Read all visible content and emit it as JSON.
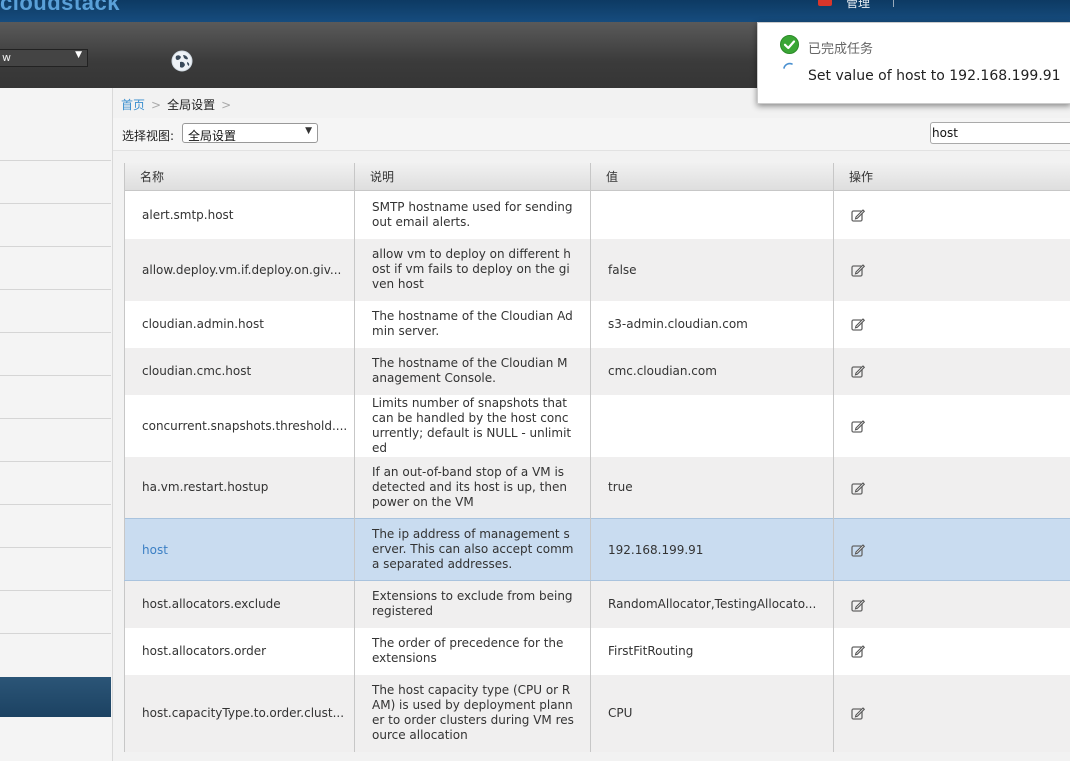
{
  "header": {
    "logo": "cloudstack",
    "user_name": "管理"
  },
  "toolbar": {
    "view_value": "w"
  },
  "breadcrumb": {
    "home": "首页",
    "separator": ">",
    "current": "全局设置",
    "trailing": ">"
  },
  "filter": {
    "label": "选择视图:",
    "selected": "全局设置",
    "search_value": "host"
  },
  "notification": {
    "done_label": "已完成任务",
    "task_text": "Set value of host to 192.168.199.91"
  },
  "table": {
    "headers": [
      "名称",
      "说明",
      "值",
      "操作"
    ],
    "rows": [
      {
        "name": "alert.smtp.host",
        "description": "SMTP hostname used for sending out email alerts.",
        "value": ""
      },
      {
        "name": "allow.deploy.vm.if.deploy.on.giv...",
        "description": "allow vm to deploy on different host if vm fails to deploy on the given host",
        "value": "false"
      },
      {
        "name": "cloudian.admin.host",
        "description": "The hostname of the Cloudian Admin server.",
        "value": "s3-admin.cloudian.com"
      },
      {
        "name": "cloudian.cmc.host",
        "description": "The hostname of the Cloudian Management Console.",
        "value": "cmc.cloudian.com"
      },
      {
        "name": "concurrent.snapshots.threshold....",
        "description": "Limits number of snapshots that can be handled by the host concurrently; default is NULL - unlimited",
        "value": ""
      },
      {
        "name": "ha.vm.restart.hostup",
        "description": "If an out-of-band stop of a VM is detected and its host is up, then power on the VM",
        "value": "true"
      },
      {
        "name": "host",
        "description": "The ip address of management server. This can also accept comma separated addresses.",
        "value": "192.168.199.91"
      },
      {
        "name": "host.allocators.exclude",
        "description": "Extensions to exclude from being registered",
        "value": "RandomAllocator,TestingAllocato..."
      },
      {
        "name": "host.allocators.order",
        "description": "The order of precedence for the extensions",
        "value": "FirstFitRouting"
      },
      {
        "name": "host.capacityType.to.order.clust...",
        "description": "The host capacity type (CPU or RAM) is used by deployment planner to order clusters during VM resource allocation",
        "value": "CPU"
      }
    ]
  },
  "colors": {
    "link": "#3b8fcf",
    "selected_row": "#c9dcf0",
    "success_green": "#3aa635"
  }
}
